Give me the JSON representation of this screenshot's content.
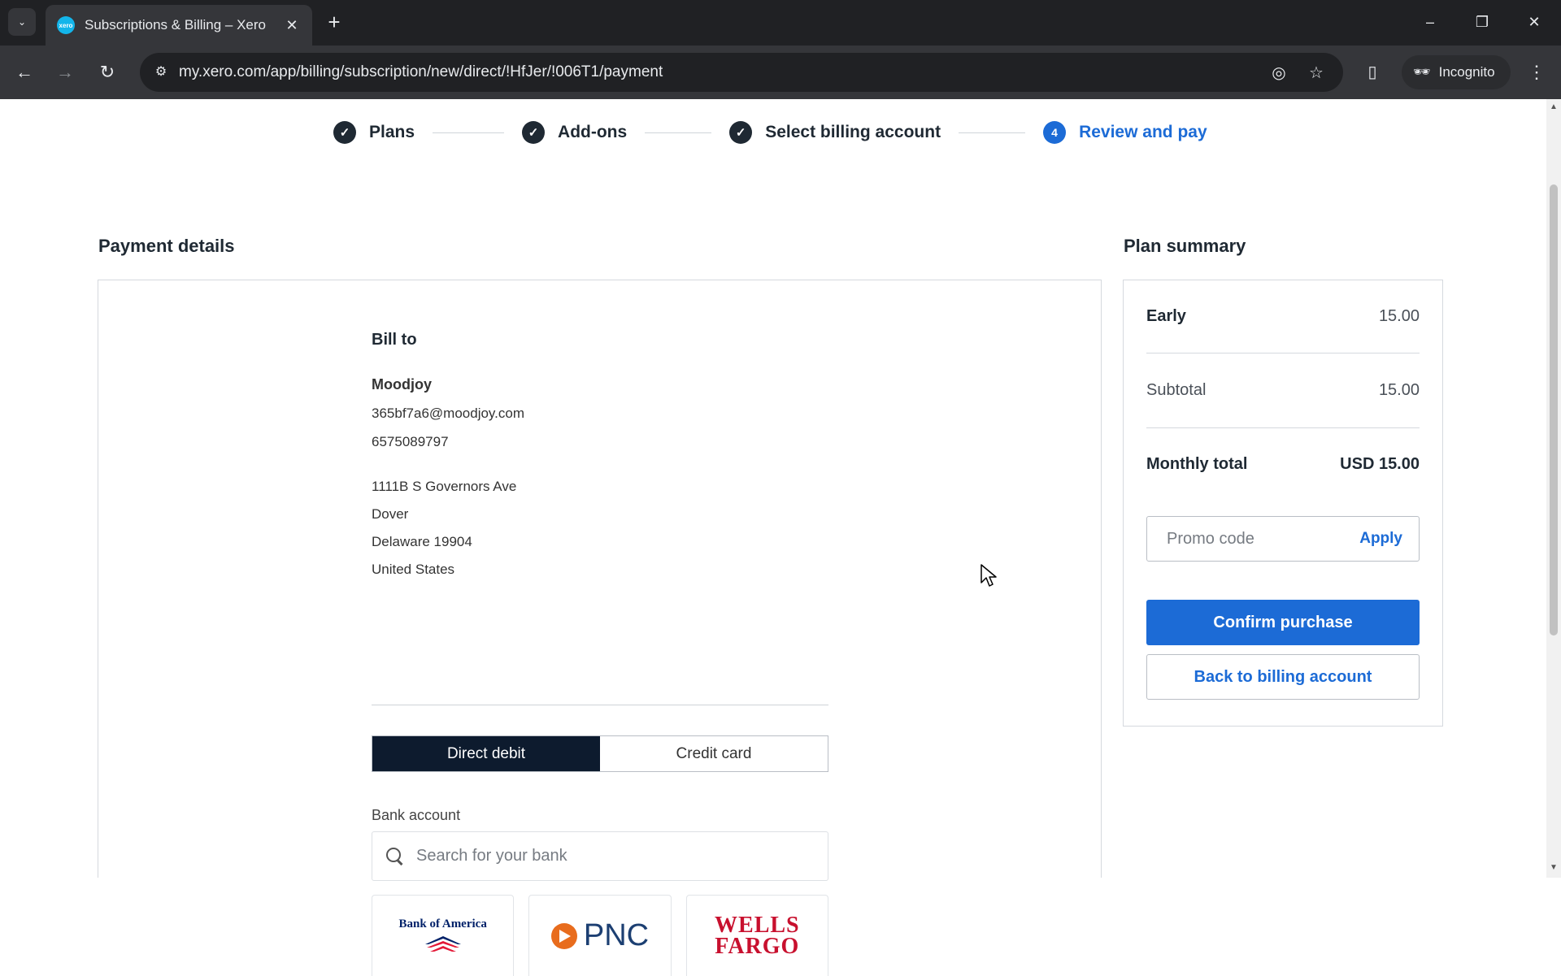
{
  "browser": {
    "tab_title": "Subscriptions & Billing – Xero",
    "url": "my.xero.com/app/billing/subscription/new/direct/!HfJer/!006T1/payment",
    "incognito_label": "Incognito",
    "favicon_text": "xero"
  },
  "stepper": {
    "steps": [
      {
        "label": "Plans",
        "state": "done"
      },
      {
        "label": "Add-ons",
        "state": "done"
      },
      {
        "label": "Select billing account",
        "state": "done"
      },
      {
        "label": "Review and pay",
        "state": "active",
        "number": "4"
      }
    ]
  },
  "payment": {
    "title": "Payment details",
    "bill_to_heading": "Bill to",
    "name": "Moodjoy",
    "email": "365bf7a6@moodjoy.com",
    "phone": "6575089797",
    "address": [
      "1111B S Governors Ave",
      "Dover",
      "Delaware 19904",
      "United States"
    ],
    "methods": [
      "Direct debit",
      "Credit card"
    ],
    "selected_method": "Direct debit",
    "bank_account_label": "Bank account",
    "bank_search_placeholder": "Search for your bank",
    "banks": {
      "boa": "Bank of America",
      "pnc": "PNC",
      "wells_fargo_line1": "WELLS",
      "wells_fargo_line2": "FARGO"
    }
  },
  "summary": {
    "title": "Plan summary",
    "plan_name": "Early",
    "plan_price": "15.00",
    "subtotal_label": "Subtotal",
    "subtotal_value": "15.00",
    "total_label": "Monthly total",
    "total_value": "USD 15.00",
    "promo_placeholder": "Promo code",
    "apply_label": "Apply",
    "confirm_label": "Confirm purchase",
    "back_label": "Back to billing account"
  },
  "colors": {
    "accent": "#1c6bd6",
    "dark_toggle": "#0d1b2e",
    "chrome_dark": "#202124"
  }
}
